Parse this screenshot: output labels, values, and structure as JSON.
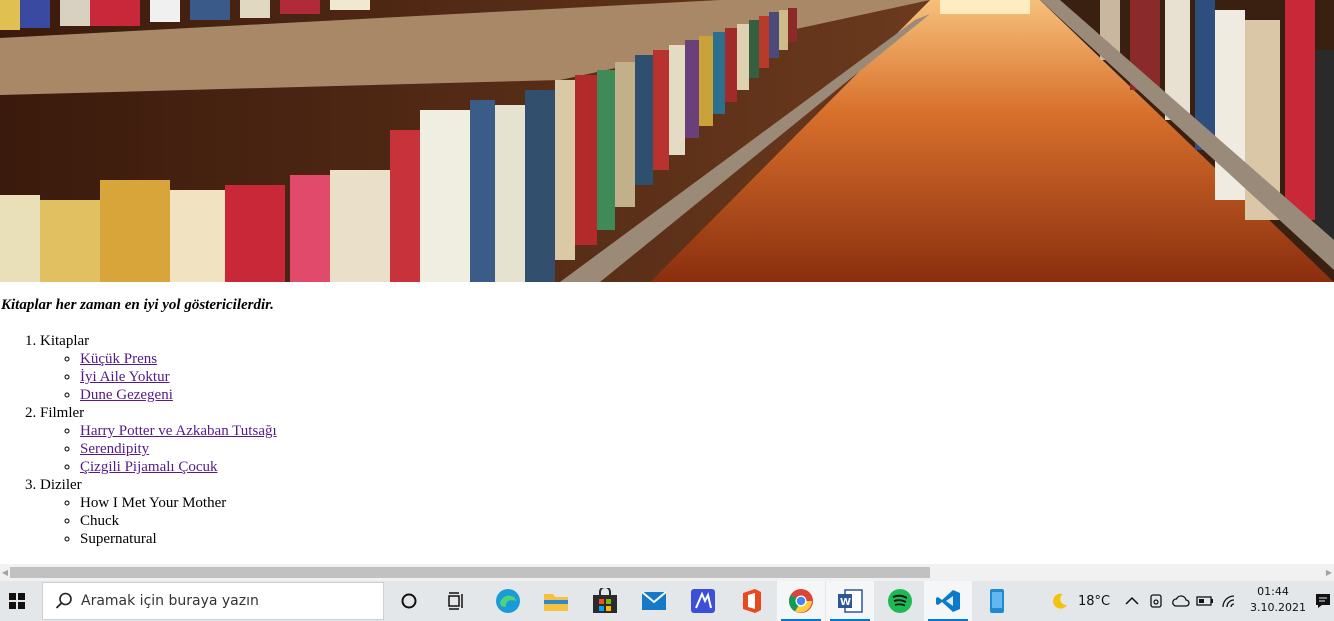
{
  "banner": {
    "alt": "library bookshelves photo"
  },
  "quote": "Kitaplar her zaman en iyi yol göstericilerdir.",
  "lists": [
    {
      "title": "Kitaplar",
      "items": [
        {
          "label": "Küçük Prens",
          "link": true
        },
        {
          "label": "İyi Aile Yoktur",
          "link": true
        },
        {
          "label": "Dune Gezegeni",
          "link": true
        }
      ]
    },
    {
      "title": "Filmler",
      "items": [
        {
          "label": "Harry Potter ve Azkaban Tutsağı",
          "link": true
        },
        {
          "label": "Serendipity",
          "link": true
        },
        {
          "label": "Çizgili Pijamalı Çocuk",
          "link": true
        }
      ]
    },
    {
      "title": "Diziler",
      "items": [
        {
          "label": "How I Met Your Mother",
          "link": false
        },
        {
          "label": "Chuck",
          "link": false
        },
        {
          "label": "Supernatural",
          "link": false
        }
      ]
    }
  ],
  "taskbar": {
    "search_placeholder": "Aramak için buraya yazın",
    "weather_temp": "18°C",
    "time": "01:44",
    "date": "3.10.2021",
    "apps": [
      "cortana-icon",
      "task-view-icon",
      "edge-icon",
      "file-explorer-icon",
      "store-icon",
      "mail-icon",
      "app-icon",
      "office-icon",
      "chrome-icon",
      "word-icon",
      "spotify-icon",
      "vscode-icon",
      "phone-app-icon"
    ],
    "colors": {
      "accent": "#0078d7",
      "link_visited": "#551a8b"
    }
  }
}
